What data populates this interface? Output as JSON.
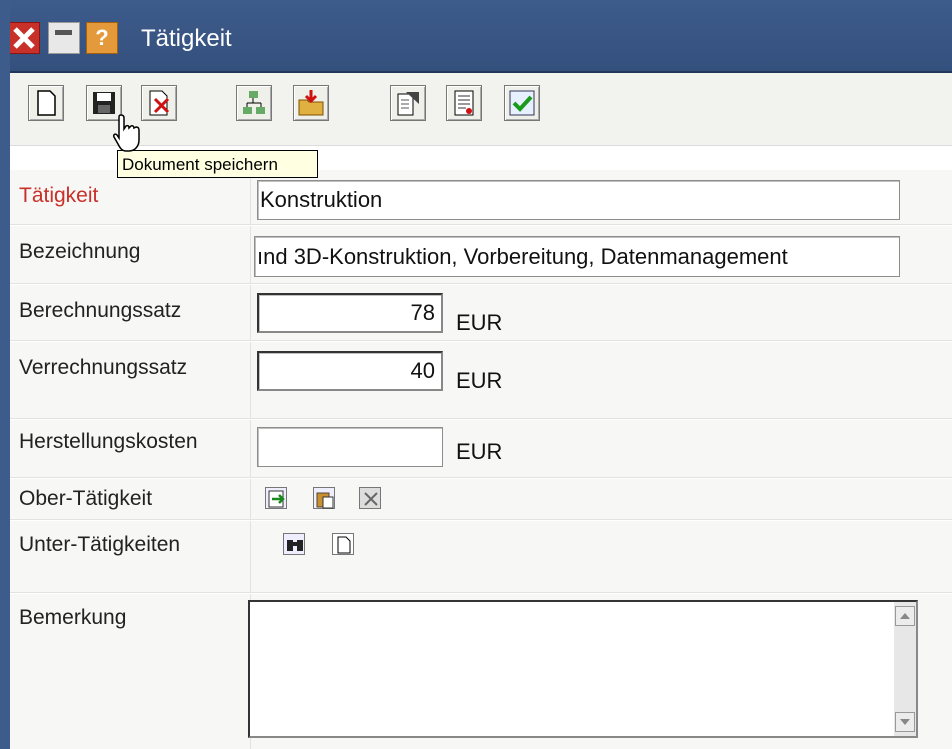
{
  "window": {
    "title": "Tätigkeit",
    "help_glyph": "?"
  },
  "toolbar": {
    "tooltip": "Dokument speichern"
  },
  "form": {
    "taetigkeit": {
      "label": "Tätigkeit",
      "value": "Konstruktion"
    },
    "bezeichnung": {
      "label": "Bezeichnung",
      "value": "ınd 3D-Konstruktion, Vorbereitung, Datenmanagement"
    },
    "berechnungssatz": {
      "label": "Berechnungssatz",
      "value": "78",
      "unit": "EUR"
    },
    "verrechnungssatz": {
      "label": "Verrechnungssatz",
      "value": "40",
      "unit": "EUR"
    },
    "herstellungskosten": {
      "label": "Herstellungskosten",
      "value": "",
      "unit": "EUR"
    },
    "ober_taetigkeit": {
      "label": "Ober-Tätigkeit"
    },
    "unter_taetigkeiten": {
      "label": "Unter-Tätigkeiten"
    },
    "bemerkung": {
      "label": "Bemerkung",
      "value": ""
    }
  },
  "colors": {
    "titlebar": "#3d5b8b",
    "required_label": "#c8302a",
    "tooltip_bg": "#ffffe1"
  },
  "icons": [
    "close-icon",
    "minimize-icon",
    "help-icon",
    "new-document-icon",
    "save-icon",
    "delete-icon",
    "tree-icon",
    "import-icon",
    "properties-icon",
    "report-icon",
    "checkmark-icon",
    "link-icon",
    "paste-icon",
    "remove-icon",
    "binoculars-icon",
    "new-sub-icon"
  ]
}
